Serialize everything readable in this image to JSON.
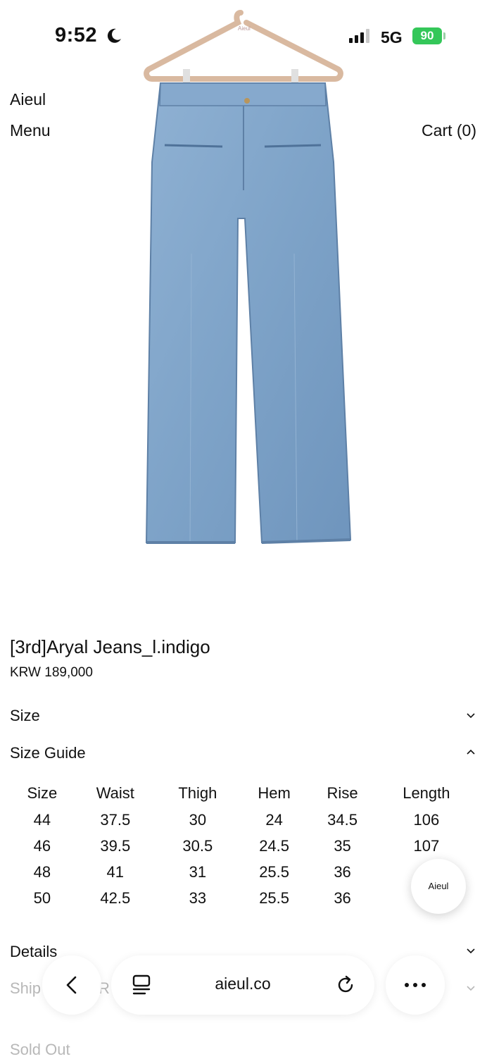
{
  "status_bar": {
    "time": "9:52",
    "network": "5G",
    "battery": "90"
  },
  "header": {
    "brand": "Aieul",
    "menu_label": "Menu",
    "cart_label": "Cart (0)"
  },
  "product": {
    "image_icon": "jeans-product-photo",
    "hanger_text": "Aieul",
    "title": "[3rd]Aryal Jeans_l.indigo",
    "price": "KRW 189,000"
  },
  "accordions": {
    "size": "Size",
    "size_guide": "Size Guide",
    "details": "Details",
    "shipping_partial": "Ship",
    "shipping_partial_2": "R"
  },
  "size_guide": {
    "headers": [
      "Size",
      "Waist",
      "Thigh",
      "Hem",
      "Rise",
      "Length"
    ],
    "rows": [
      [
        "44",
        "37.5",
        "30",
        "24",
        "34.5",
        "106"
      ],
      [
        "46",
        "39.5",
        "30.5",
        "24.5",
        "35",
        "107"
      ],
      [
        "48",
        "41",
        "31",
        "25.5",
        "36",
        ""
      ],
      [
        "50",
        "42.5",
        "33",
        "25.5",
        "36",
        ""
      ]
    ]
  },
  "chat": {
    "label": "Aieul"
  },
  "footer": {
    "sold_out": "Sold Out"
  },
  "browser": {
    "url": "aieul.co"
  },
  "colors": {
    "battery": "#34c759",
    "denim": "#7fa3c9",
    "text": "#111111",
    "faded": "#b8b8b8"
  }
}
